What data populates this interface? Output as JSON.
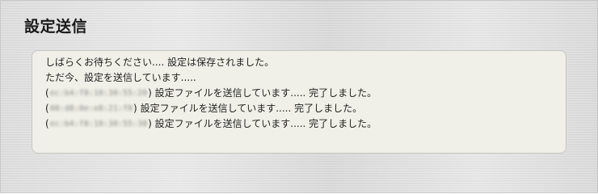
{
  "page": {
    "title": "設定送信"
  },
  "messages": {
    "line1": "しばらくお待ちください.... 設定は保存されました。",
    "line2": "ただ今、設定を送信しています.....",
    "devices": [
      {
        "id": "ec:b4:f8:10:30:55:20",
        "status": "設定ファイルを送信しています..... 完了しました。"
      },
      {
        "id": "08:d8:0e:e8:21:f8",
        "status": "設定ファイルを送信しています..... 完了しました。"
      },
      {
        "id": "ec:b4:f8:10:30:55:38",
        "status": "設定ファイルを送信しています..... 完了しました。"
      }
    ]
  }
}
